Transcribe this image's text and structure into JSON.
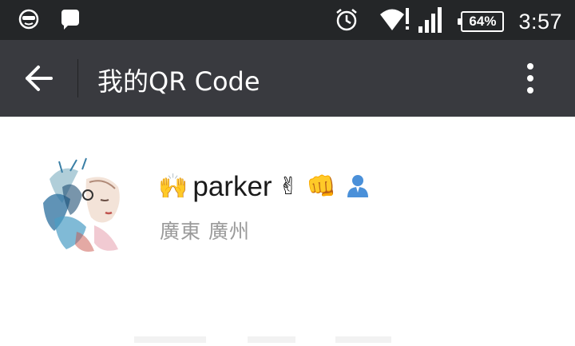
{
  "status_bar": {
    "left_icons": [
      "glasses-face-icon",
      "chat-bubble-icon"
    ],
    "right_icons": [
      "alarm-clock-icon",
      "wifi-alert-icon",
      "signal-icon"
    ],
    "battery": "64%",
    "time": "3:57"
  },
  "app_bar": {
    "title": "我的QR Code",
    "back_icon": "arrow-left-icon",
    "more_icon": "more-vertical-icon"
  },
  "profile": {
    "name": "parker",
    "name_prefix_emoji": "🙌",
    "name_suffix_emojis": [
      "✌",
      "👊",
      "👤"
    ],
    "location": "廣東 廣州"
  },
  "colors": {
    "status_bar_bg": "#242628",
    "app_bar_bg": "#393a3f",
    "page_bg": "#ffffff",
    "name_color": "#1a1a1a",
    "location_color": "#9a9a9a"
  }
}
